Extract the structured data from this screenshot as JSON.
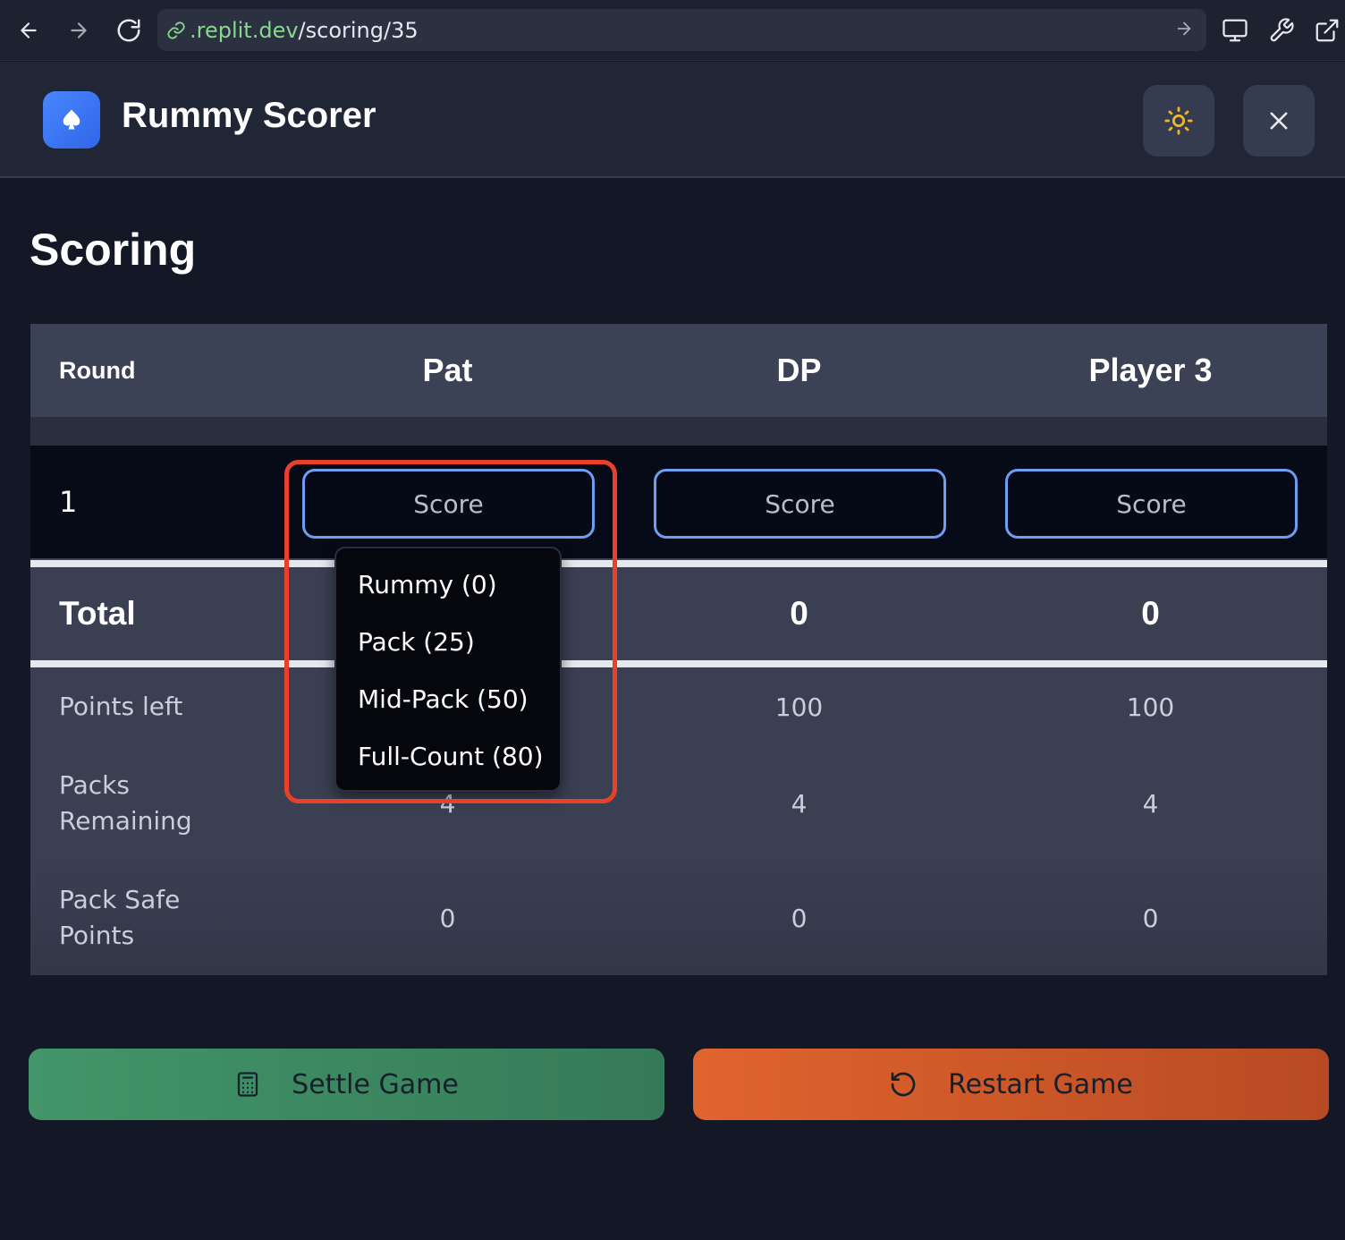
{
  "browser": {
    "url_domain": ".replit.dev",
    "url_path": "/scoring/35"
  },
  "app": {
    "title": "Rummy Scorer"
  },
  "page": {
    "title": "Scoring"
  },
  "table": {
    "round_header": "Round",
    "players": [
      "Pat",
      "DP",
      "Player 3"
    ],
    "rounds": [
      {
        "number": "1",
        "score_placeholder": "Score"
      }
    ],
    "total_label": "Total",
    "totals": [
      "",
      "0",
      "0"
    ],
    "points_left_label": "Points left",
    "points_left": [
      "",
      "100",
      "100"
    ],
    "packs_remaining_label_1": "Packs",
    "packs_remaining_label_2": "Remaining",
    "packs_remaining": [
      "4",
      "4",
      "4"
    ],
    "pack_safe_label_1": "Pack Safe",
    "pack_safe_label_2": "Points",
    "pack_safe": [
      "0",
      "0",
      "0"
    ]
  },
  "dropdown": {
    "options": [
      "Rummy (0)",
      "Pack (25)",
      "Mid-Pack (50)",
      "Full-Count (80)"
    ]
  },
  "actions": {
    "settle_label": "Settle Game",
    "restart_label": "Restart Game"
  },
  "colors": {
    "accent_blue": "#4a86ff",
    "settle_green": "#43956a",
    "restart_orange": "#e0642e",
    "highlight_red": "#e8402b",
    "sun_yellow": "#f0b429"
  },
  "icons": {
    "back": "arrow-left-icon",
    "forward": "arrow-right-icon",
    "reload": "reload-icon",
    "link": "link-icon",
    "go": "arrow-right-icon",
    "monitor": "monitor-icon",
    "wrench": "wrench-icon",
    "external": "external-link-icon",
    "logo": "spade-icon",
    "theme": "sun-icon",
    "close": "close-icon",
    "settle": "calculator-icon",
    "restart": "rotate-ccw-icon"
  }
}
